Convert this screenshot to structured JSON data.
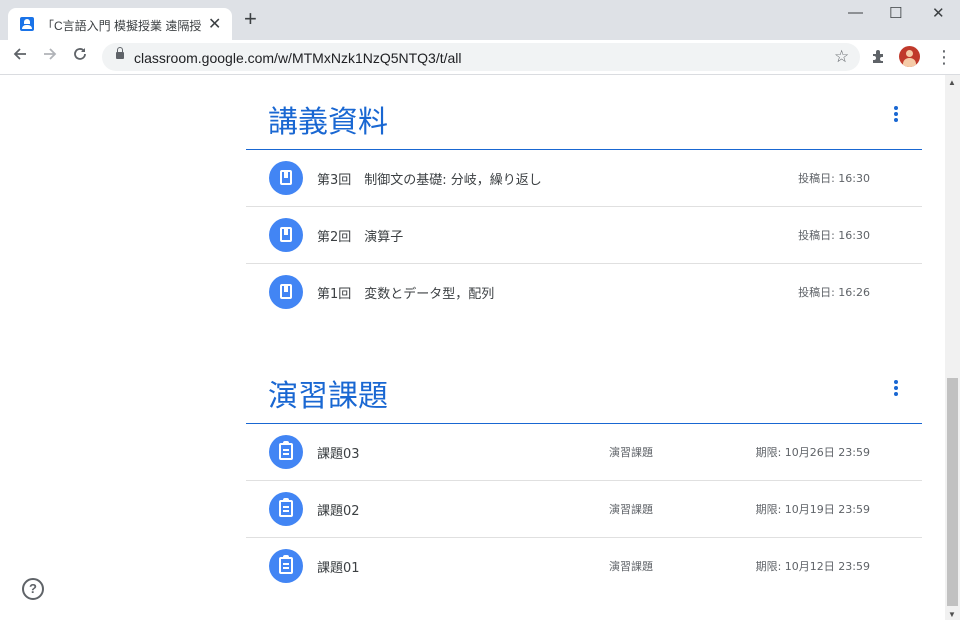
{
  "browser": {
    "tab_title": "「C言語入門 模擬授業 遠隔授業W",
    "tab_close": "✕",
    "new_tab": "+",
    "url": "classroom.google.com/w/MTMxNzk1NzQ5NTQ3/t/all",
    "window_controls": {
      "minimize": "—",
      "maximize": "☐",
      "close": "✕"
    },
    "icons": [
      "back-icon",
      "forward-icon",
      "reload-icon",
      "lock-icon",
      "star-icon",
      "extensions-icon",
      "avatar",
      "menu-icon"
    ]
  },
  "sections": [
    {
      "title": "講義資料",
      "items": [
        {
          "icon": "material-icon",
          "title": "第3回　制御文の基礎: 分岐，繰り返し",
          "type": "",
          "meta": "投稿日: 16:30"
        },
        {
          "icon": "material-icon",
          "title": "第2回　演算子",
          "type": "",
          "meta": "投稿日: 16:30"
        },
        {
          "icon": "material-icon",
          "title": "第1回　変数とデータ型，配列",
          "type": "",
          "meta": "投稿日: 16:26"
        }
      ]
    },
    {
      "title": "演習課題",
      "items": [
        {
          "icon": "assignment-icon",
          "title": "課題03",
          "type": "演習課題",
          "meta": "期限: 10月26日 23:59"
        },
        {
          "icon": "assignment-icon",
          "title": "課題02",
          "type": "演習課題",
          "meta": "期限: 10月19日 23:59"
        },
        {
          "icon": "assignment-icon",
          "title": "課題01",
          "type": "演習課題",
          "meta": "期限: 10月12日 23:59"
        }
      ]
    }
  ],
  "help": {
    "label": "?"
  },
  "colors": {
    "accent": "#1967d2",
    "icon_bg": "#4285f4",
    "tabstrip": "#dee1e6"
  }
}
